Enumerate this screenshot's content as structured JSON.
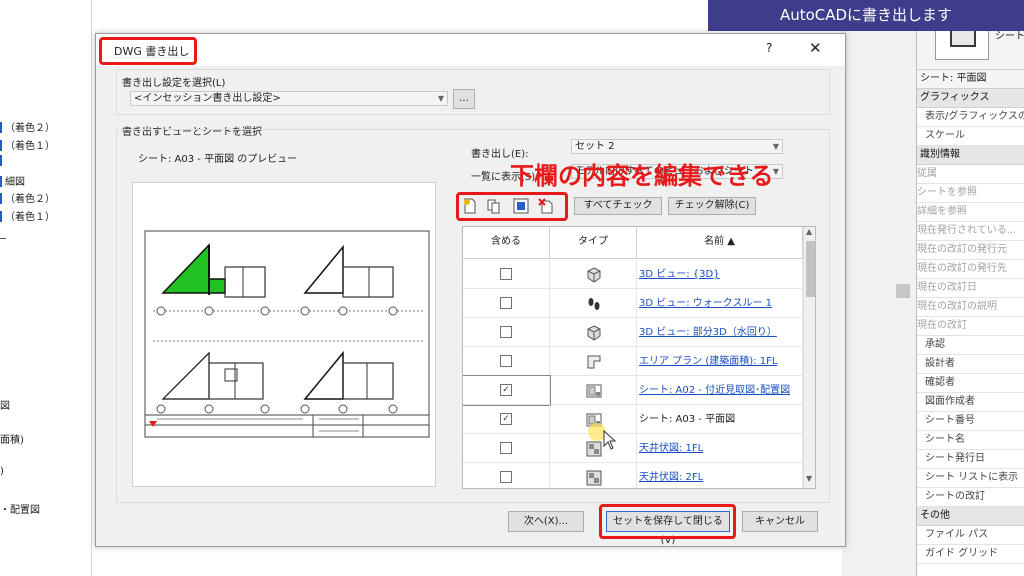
{
  "banner": {
    "text": "AutoCADに書き出します"
  },
  "overlay_annotation": "下欄の内容を編集できる",
  "left_panel": {
    "items": [
      "（着色２）",
      "（着色１）",
      "",
      "細図",
      "（着色２）",
      "（着色１）",
      "図",
      "面積)",
      ")",
      "・配置図"
    ]
  },
  "properties": {
    "thumb_label": "シート",
    "selector": "シート: 平面図",
    "rows": [
      {
        "text": "グラフィックス",
        "kind": "header"
      },
      {
        "text": "表示/グラフィックスの...",
        "kind": "indent"
      },
      {
        "text": "スケール",
        "kind": "indent"
      },
      {
        "text": "識別情報",
        "kind": "header"
      },
      {
        "text": "従属",
        "kind": "gray"
      },
      {
        "text": "シートを参照",
        "kind": "gray"
      },
      {
        "text": "詳細を参照",
        "kind": "gray"
      },
      {
        "text": "現在発行されている...",
        "kind": "gray"
      },
      {
        "text": "現在の改訂の発行元",
        "kind": "gray"
      },
      {
        "text": "現在の改訂の発行先",
        "kind": "gray"
      },
      {
        "text": "現在の改訂日",
        "kind": "gray"
      },
      {
        "text": "現在の改訂の説明",
        "kind": "gray"
      },
      {
        "text": "現在の改訂",
        "kind": "gray"
      },
      {
        "text": "承認",
        "kind": "indent"
      },
      {
        "text": "設計者",
        "kind": "indent"
      },
      {
        "text": "確認者",
        "kind": "indent"
      },
      {
        "text": "図面作成者",
        "kind": "indent"
      },
      {
        "text": "シート番号",
        "kind": "indent"
      },
      {
        "text": "シート名",
        "kind": "indent"
      },
      {
        "text": "シート発行日",
        "kind": "indent"
      },
      {
        "text": "シート リストに表示",
        "kind": "indent"
      },
      {
        "text": "シートの改訂",
        "kind": "indent"
      },
      {
        "text": "その他",
        "kind": "header"
      },
      {
        "text": "ファイル パス",
        "kind": "indent"
      },
      {
        "text": "ガイド グリッド",
        "kind": "indent"
      }
    ]
  },
  "dialog": {
    "title": "DWG 書き出し",
    "help": "?",
    "close": "✕",
    "settings_label": "書き出し設定を選択(L)",
    "settings_value": "<インセッション書き出し設定>",
    "settings_button": "...",
    "views_group_label": "書き出すビューとシートを選択",
    "preview_label": "シート: A03 - 平面図 のプレビュー",
    "export_label": "書き出し(E):",
    "export_value": "セット 2",
    "show_label": "一覧に表示(S):",
    "show_value": "モデル内のすべてのビューおよびシート",
    "check_all_button": "すべてチェック",
    "check_none_button": "チェック解除(C)",
    "tools": [
      "new-set-icon",
      "duplicate-set-icon",
      "rename-set-icon",
      "delete-set-icon"
    ],
    "table": {
      "headers": [
        "含める",
        "タイプ",
        "名前 ▲"
      ],
      "rows": [
        {
          "checked": false,
          "type": "3d-view-icon",
          "name": "3D ビュー: {3D}",
          "link": true
        },
        {
          "checked": false,
          "type": "walkthrough-icon",
          "name": "3D ビュー: ウォークスルー 1",
          "link": true
        },
        {
          "checked": false,
          "type": "3d-view-icon",
          "name": "3D ビュー: 部分3D（水回り）",
          "link": true
        },
        {
          "checked": false,
          "type": "area-plan-icon",
          "name": "エリア プラン (建築面積): 1FL",
          "link": true
        },
        {
          "checked": true,
          "type": "sheet-icon",
          "name": "シート: A02 - 付近見取図･配置図",
          "link": true
        },
        {
          "checked": true,
          "type": "sheet-icon",
          "name": "シート: A03 - 平面図",
          "link": false
        },
        {
          "checked": false,
          "type": "ceiling-plan-icon",
          "name": "天井伏図: 1FL",
          "link": true
        },
        {
          "checked": false,
          "type": "ceiling-plan-icon",
          "name": "天井伏図: 2FL",
          "link": true
        }
      ]
    },
    "buttons": {
      "next": "次へ(X)...",
      "save_close": "セットを保存して閉じる(V)",
      "cancel": "キャンセル"
    }
  },
  "colors": {
    "accent_red": "#e8191a",
    "banner": "#3d3d8c",
    "link": "#1a4fc4",
    "room_fill": "#22c122"
  }
}
